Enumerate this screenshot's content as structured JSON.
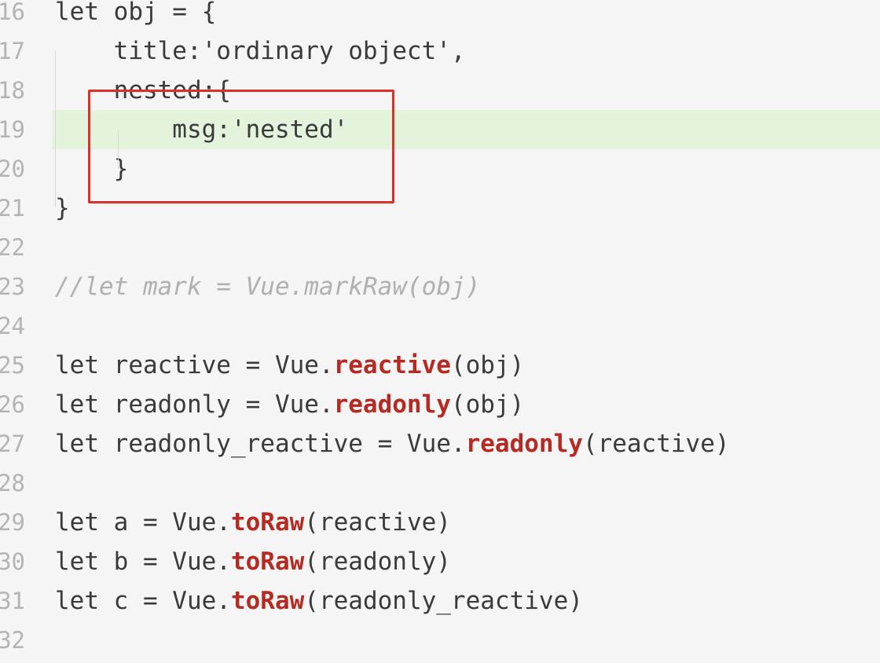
{
  "editor": {
    "lines": [
      {
        "num": "16",
        "segments": [
          {
            "t": "let obj = {",
            "k": "plain"
          }
        ]
      },
      {
        "num": "17",
        "segments": [
          {
            "t": "    title:'ordinary object',",
            "k": "plain"
          }
        ]
      },
      {
        "num": "18",
        "segments": [
          {
            "t": "    nested:{",
            "k": "plain"
          }
        ]
      },
      {
        "num": "19",
        "segments": [
          {
            "t": "        msg:'nested'",
            "k": "plain"
          }
        ],
        "highlighted": true
      },
      {
        "num": "20",
        "segments": [
          {
            "t": "    }",
            "k": "plain"
          }
        ]
      },
      {
        "num": "21",
        "segments": [
          {
            "t": "}",
            "k": "plain"
          }
        ]
      },
      {
        "num": "22",
        "segments": []
      },
      {
        "num": "23",
        "segments": [
          {
            "t": "//let mark = Vue.markRaw(obj)",
            "k": "comment"
          }
        ]
      },
      {
        "num": "24",
        "segments": []
      },
      {
        "num": "25",
        "segments": [
          {
            "t": "let reactive = Vue.",
            "k": "plain"
          },
          {
            "t": "reactive",
            "k": "fn"
          },
          {
            "t": "(obj)",
            "k": "plain"
          }
        ]
      },
      {
        "num": "26",
        "segments": [
          {
            "t": "let readonly = Vue.",
            "k": "plain"
          },
          {
            "t": "readonly",
            "k": "fn"
          },
          {
            "t": "(obj)",
            "k": "plain"
          }
        ]
      },
      {
        "num": "27",
        "segments": [
          {
            "t": "let readonly_reactive = Vue.",
            "k": "plain"
          },
          {
            "t": "readonly",
            "k": "fn"
          },
          {
            "t": "(reactive)",
            "k": "plain"
          }
        ]
      },
      {
        "num": "28",
        "segments": []
      },
      {
        "num": "29",
        "segments": [
          {
            "t": "let a = Vue.",
            "k": "plain"
          },
          {
            "t": "toRaw",
            "k": "fn"
          },
          {
            "t": "(reactive)",
            "k": "plain"
          }
        ]
      },
      {
        "num": "30",
        "segments": [
          {
            "t": "let b = Vue.",
            "k": "plain"
          },
          {
            "t": "toRaw",
            "k": "fn"
          },
          {
            "t": "(readonly)",
            "k": "plain"
          }
        ]
      },
      {
        "num": "31",
        "segments": [
          {
            "t": "let c = Vue.",
            "k": "plain"
          },
          {
            "t": "toRaw",
            "k": "fn"
          },
          {
            "t": "(readonly_reactive)",
            "k": "plain"
          }
        ]
      },
      {
        "num": "32",
        "segments": []
      }
    ]
  },
  "colors": {
    "background": "#f5f5f5",
    "highlight": "#e4f4dc",
    "function_call": "#b52a22",
    "annotation_box": "#d9302a",
    "comment": "#b0b0b0",
    "line_number": "#b4b4b4"
  }
}
